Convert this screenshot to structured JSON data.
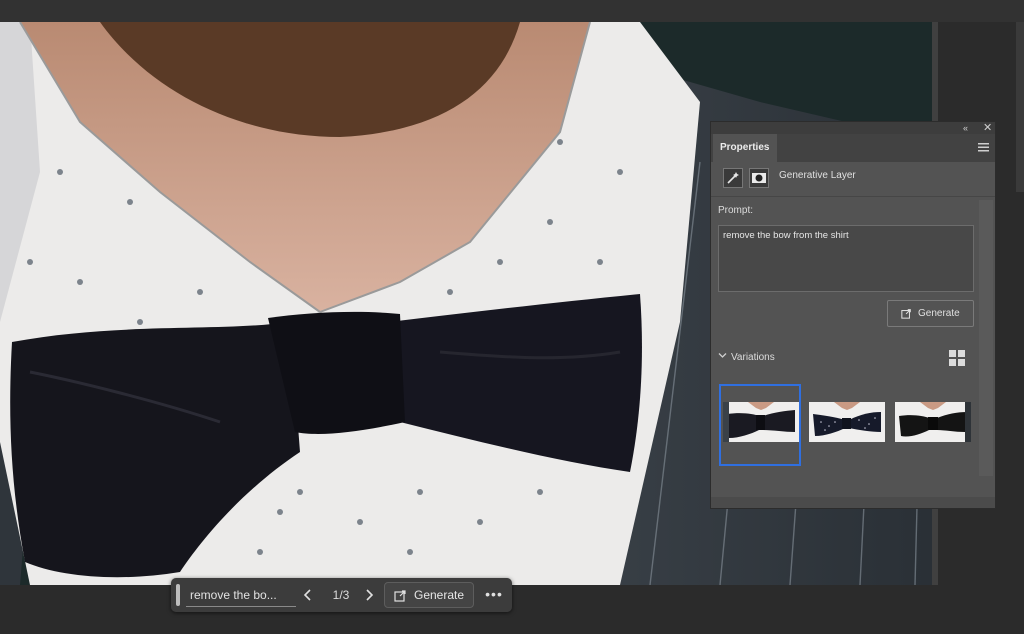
{
  "taskbar": {
    "prompt_text": "remove the bo...",
    "counter": "1/3",
    "generate_label": "Generate",
    "more_label": "•••"
  },
  "panel": {
    "tab_label": "Properties",
    "collapse_label": "«",
    "close_label": "✕",
    "layer_name": "Generative Layer",
    "prompt_label": "Prompt:",
    "prompt_value": "remove the bow from the shirt",
    "generate_label": "Generate",
    "variations_label": "Variations",
    "variations": [
      {
        "name": "variation-1",
        "selected": true,
        "bow_color": "#1a1a22"
      },
      {
        "name": "variation-2",
        "selected": false,
        "bow_color": "#161a2a"
      },
      {
        "name": "variation-3",
        "selected": false,
        "bow_color": "#141414"
      }
    ]
  },
  "icons": {
    "prev": "chevron-left-icon",
    "next": "chevron-right-icon",
    "generate": "generate-icon",
    "menu": "hamburger-menu-icon",
    "grid": "grid-view-icon",
    "expand": "chevron-down-icon"
  },
  "colors": {
    "selection_accent": "#2f6fe0",
    "panel_bg": "#535353",
    "app_bg": "#2b2b2b"
  }
}
